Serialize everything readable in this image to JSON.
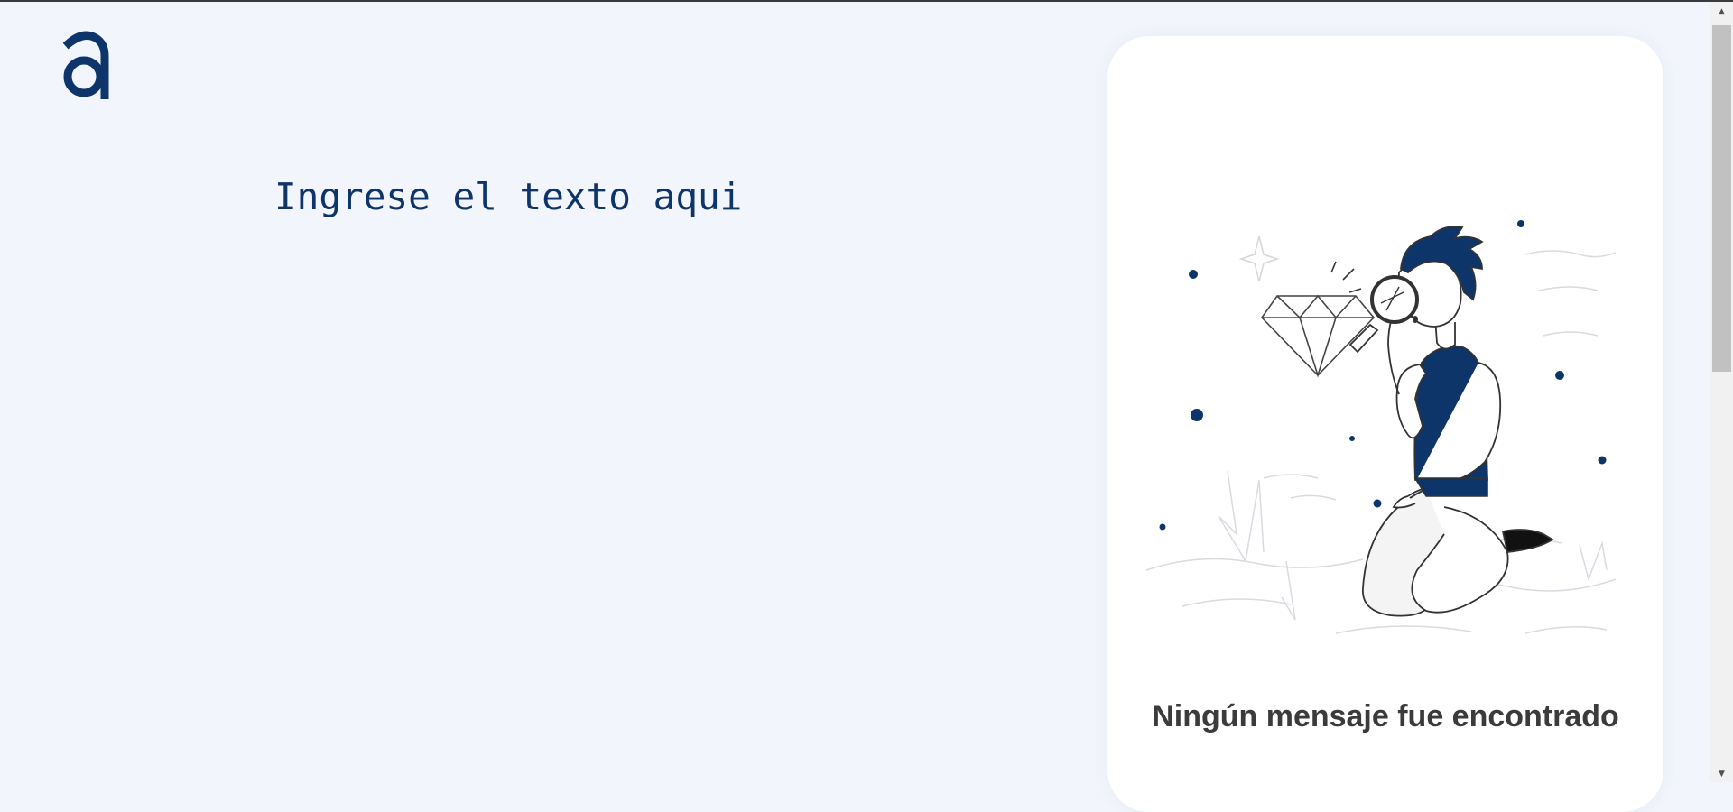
{
  "app": {
    "logo_letter": "a",
    "brand_color": "#0e356a",
    "background_color": "#f2f5fc"
  },
  "editor": {
    "placeholder": "Ingrese el texto aqui"
  },
  "messages_panel": {
    "empty_title": "Ningún mensaje fue encontrado",
    "illustration_icon": "search-diamond-illustration"
  },
  "scrollbar": {
    "up_icon": "▲",
    "down_icon": "▼"
  }
}
